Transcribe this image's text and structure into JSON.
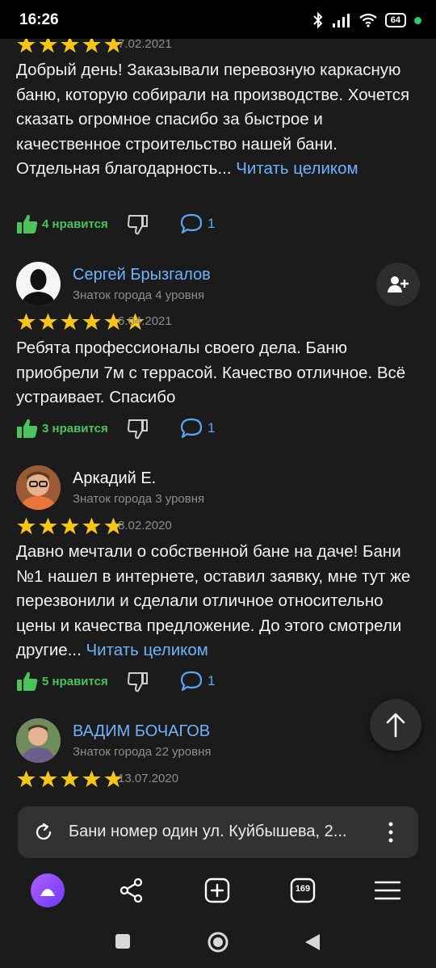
{
  "status": {
    "time": "16:26",
    "battery": "64"
  },
  "reviews": [
    {
      "date": "7.02.2021",
      "text": "Добрый день! Заказывали перевозную каркасную баню, которую собирали на производстве. Хочется сказать огромное спасибо за быстрое и качественное строительство нашей бани. Отдельная благодарность...",
      "more": "Читать целиком",
      "likes": "4 нравится",
      "comments": "1",
      "rating": 5
    },
    {
      "author": "Сергей Брызгалов",
      "level": "Знаток города 4 уровня",
      "date": "6.04.2021",
      "text": "Ребята профессионалы своего дела. Баню приобрели 7м с террасой. Качество отличное. Всё устраивает. Спасибо",
      "likes": "3 нравится",
      "comments": "1",
      "rating": 5
    },
    {
      "author": "Аркадий Е.",
      "level": "Знаток города 3 уровня",
      "date": "8.02.2020",
      "text": "Давно мечтали о собственной бане на даче! Бани №1 нашел в интернете, оставил заявку, мне тут же перезвонили и сделали отличное относительно цены и качества предложение. До этого смотрели другие...",
      "more": "Читать целиком",
      "likes": "5 нравится",
      "comments": "1",
      "rating": 5
    },
    {
      "author": "ВАДИМ БОЧАГОВ",
      "level": "Знаток города 22 уровня",
      "date": "13.07.2020",
      "rating": 5
    }
  ],
  "browser": {
    "url_title": "Бани номер один ул. Куйбышева, 2...",
    "tabs_count": "169"
  }
}
